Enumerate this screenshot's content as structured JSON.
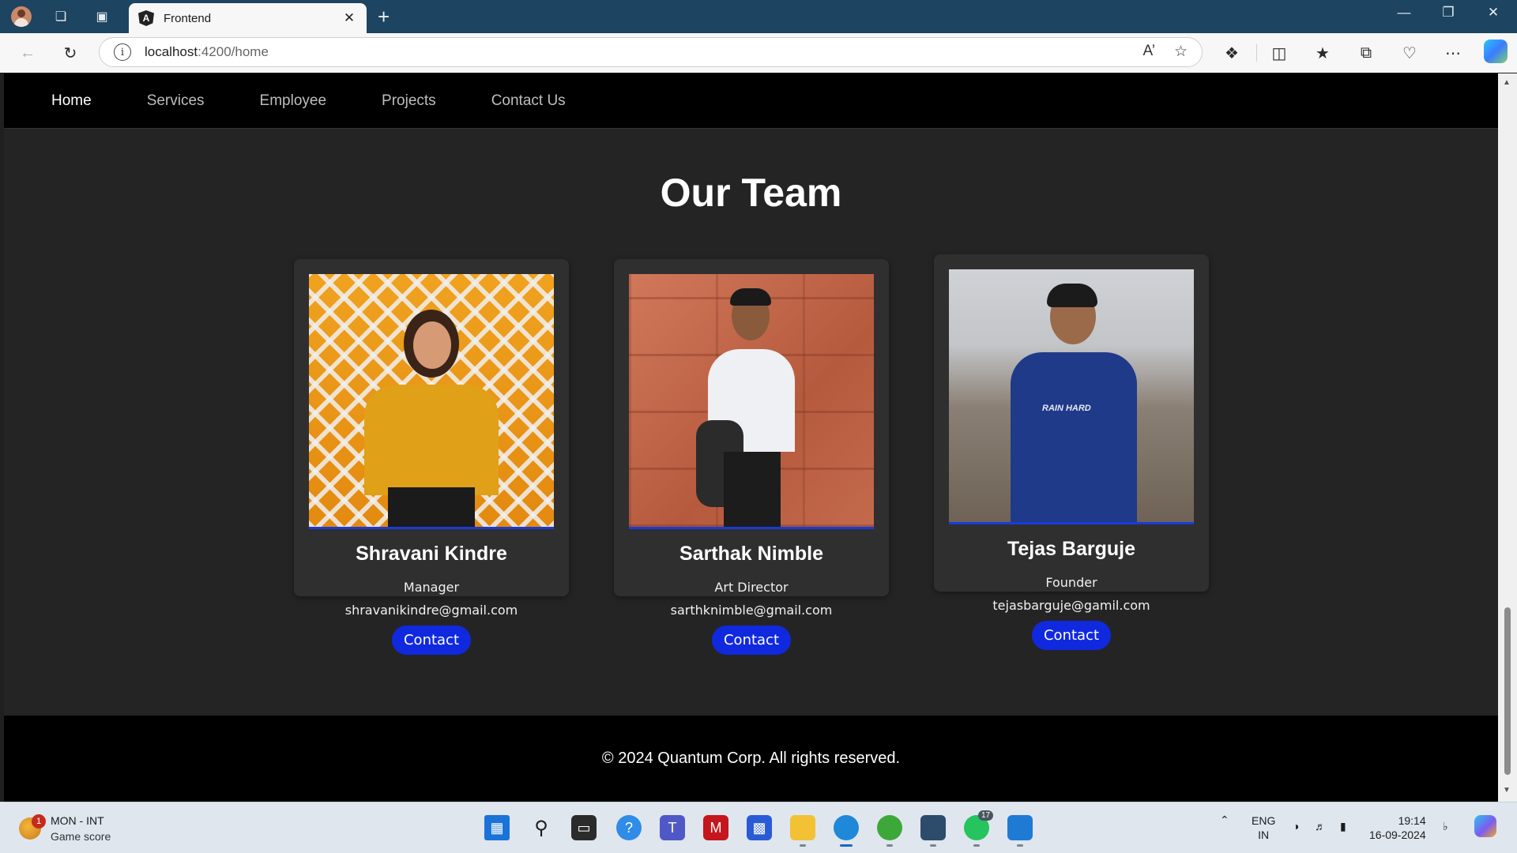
{
  "browser": {
    "tab_title": "Frontend",
    "tab_logo_letter": "A",
    "url_host": "localhost",
    "url_path": ":4200/home",
    "new_tab": "+"
  },
  "site": {
    "nav": [
      "Home",
      "Services",
      "Employee",
      "Projects",
      "Contact Us"
    ],
    "active_nav": "Home",
    "section_title": "Our Team",
    "members": [
      {
        "name": "Shravani Kindre",
        "role": "Manager",
        "email": "shravanikindre@gmail.com",
        "button": "Contact"
      },
      {
        "name": "Sarthak Nimble",
        "role": "Art Director",
        "email": "sarthknimble@gmail.com",
        "button": "Contact"
      },
      {
        "name": "Tejas Barguje",
        "role": "Founder",
        "email": "tejasbarguje@gamil.com",
        "button": "Contact"
      }
    ],
    "footer": "© 2024 Quantum Corp. All rights reserved.",
    "shirt_text": "RAIN HARD"
  },
  "taskbar": {
    "weather_badge": "1",
    "weather_title": "MON - INT",
    "weather_sub": "Game score",
    "whatsapp_badge": "17",
    "lang_top": "ENG",
    "lang_bottom": "IN",
    "time": "19:14",
    "date": "16-09-2024"
  },
  "colors": {
    "accent_button": "#1029df",
    "page_bg": "#242424",
    "card_bg": "#2f2f2f",
    "titlebar": "#1d4460"
  }
}
